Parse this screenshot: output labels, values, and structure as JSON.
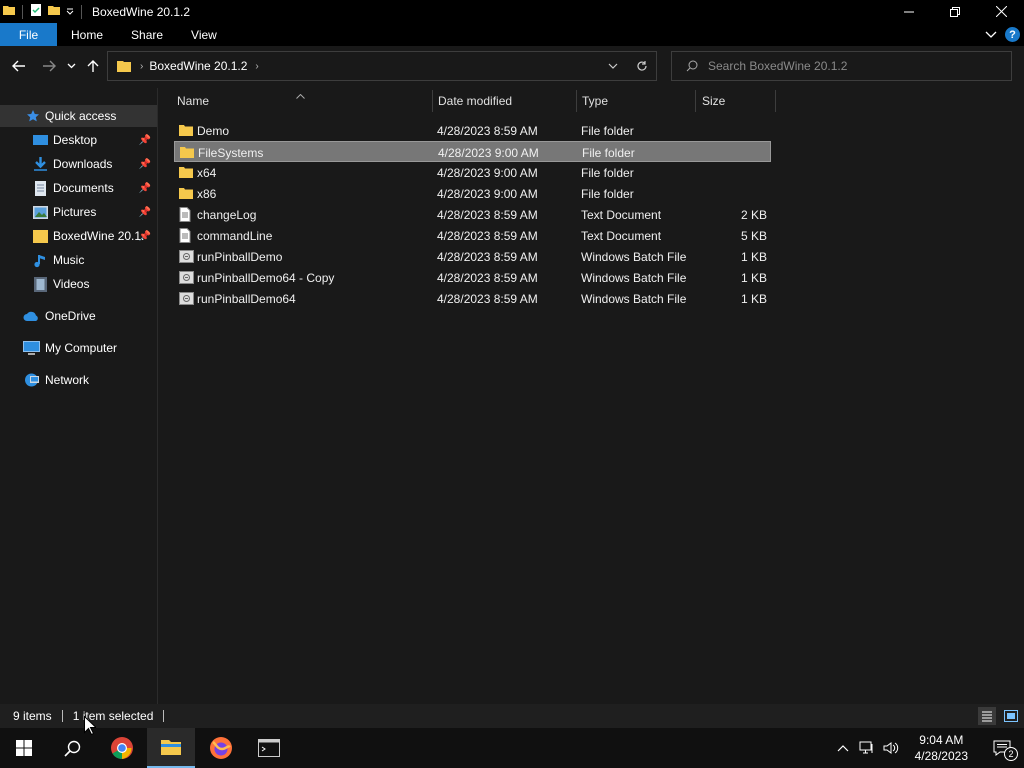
{
  "window": {
    "title": "BoxedWine 20.1.2"
  },
  "ribbon": {
    "tabs": [
      "File",
      "Home",
      "Share",
      "View"
    ]
  },
  "address": {
    "crumb": "BoxedWine 20.1.2",
    "search_placeholder": "Search BoxedWine 20.1.2"
  },
  "nav": {
    "quick_access": "Quick access",
    "pinned": [
      {
        "label": "Desktop",
        "icon": "desktop-icon",
        "pinned": true
      },
      {
        "label": "Downloads",
        "icon": "download-icon",
        "pinned": true
      },
      {
        "label": "Documents",
        "icon": "documents-icon",
        "pinned": true
      },
      {
        "label": "Pictures",
        "icon": "pictures-icon",
        "pinned": true
      },
      {
        "label": "BoxedWine 20.1.",
        "icon": "folder-icon",
        "pinned": true
      },
      {
        "label": "Music",
        "icon": "music-icon",
        "pinned": false
      },
      {
        "label": "Videos",
        "icon": "videos-icon",
        "pinned": false
      }
    ],
    "onedrive": "OneDrive",
    "mycomputer": "My Computer",
    "network": "Network"
  },
  "columns": {
    "name": "Name",
    "date": "Date modified",
    "type": "Type",
    "size": "Size"
  },
  "files": [
    {
      "name": "Demo",
      "date": "4/28/2023 8:59 AM",
      "type": "File folder",
      "size": "",
      "icon": "folder-icon",
      "selected": false
    },
    {
      "name": "FileSystems",
      "date": "4/28/2023 9:00 AM",
      "type": "File folder",
      "size": "",
      "icon": "folder-icon",
      "selected": true
    },
    {
      "name": "x64",
      "date": "4/28/2023 9:00 AM",
      "type": "File folder",
      "size": "",
      "icon": "folder-icon",
      "selected": false
    },
    {
      "name": "x86",
      "date": "4/28/2023 9:00 AM",
      "type": "File folder",
      "size": "",
      "icon": "folder-icon",
      "selected": false
    },
    {
      "name": "changeLog",
      "date": "4/28/2023 8:59 AM",
      "type": "Text Document",
      "size": "2 KB",
      "icon": "text-file-icon",
      "selected": false
    },
    {
      "name": "commandLine",
      "date": "4/28/2023 8:59 AM",
      "type": "Text Document",
      "size": "5 KB",
      "icon": "text-file-icon",
      "selected": false
    },
    {
      "name": "runPinballDemo",
      "date": "4/28/2023 8:59 AM",
      "type": "Windows Batch File",
      "size": "1 KB",
      "icon": "batch-file-icon",
      "selected": false
    },
    {
      "name": "runPinballDemo64 - Copy",
      "date": "4/28/2023 8:59 AM",
      "type": "Windows Batch File",
      "size": "1 KB",
      "icon": "batch-file-icon",
      "selected": false
    },
    {
      "name": "runPinballDemo64",
      "date": "4/28/2023 8:59 AM",
      "type": "Windows Batch File",
      "size": "1 KB",
      "icon": "batch-file-icon",
      "selected": false
    }
  ],
  "status": {
    "count": "9 items",
    "selection": "1 item selected"
  },
  "taskbar": {
    "time": "9:04 AM",
    "date": "4/28/2023",
    "notifications": "2"
  },
  "colors": {
    "accent": "#1979ca",
    "folder": "#f5c84c",
    "selection": "#777777"
  }
}
